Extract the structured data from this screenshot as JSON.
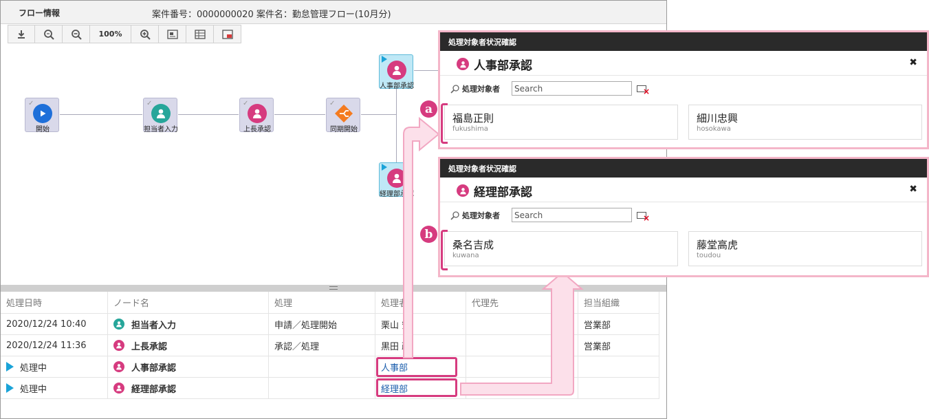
{
  "window": {
    "title": "フロー情報",
    "case_info": "案件番号：0000000020 案件名：勤怠管理フロー(10月分)"
  },
  "toolbar": {
    "zoom_label": "100%",
    "buttons": [
      "download-icon",
      "zoom-fit-icon",
      "zoom-out-icon",
      "zoom-in-icon",
      "map-icon",
      "table-icon",
      "panel-icon"
    ]
  },
  "nodes": {
    "start": "開始",
    "tantou": "担当者入力",
    "joucho": "上長承認",
    "douki": "同期開始",
    "jinji": "人事部承認",
    "keiri": "経理部承認"
  },
  "history": {
    "headers": [
      "処理日時",
      "ノード名",
      "処理",
      "処理者",
      "代理先",
      "担当組織"
    ],
    "rows": [
      {
        "date": "2020/12/24 10:40",
        "node": "担当者入力",
        "action": "申請／処理開始",
        "user": "栗山 安",
        "proxy": "",
        "org": "営業部"
      },
      {
        "date": "2020/12/24 11:36",
        "node": "上長承認",
        "action": "承認／処理",
        "user": "黒田 政",
        "proxy": "",
        "org": "営業部"
      },
      {
        "date": "処理中",
        "node": "人事部承認",
        "action": "",
        "user": "人事部",
        "proxy": "",
        "org": ""
      },
      {
        "date": "処理中",
        "node": "経理部承認",
        "action": "",
        "user": "経理部",
        "proxy": "",
        "org": ""
      }
    ]
  },
  "popups": [
    {
      "header": "処理対象者状況確認",
      "title": "人事部承認",
      "search_label": "処理対象者",
      "search_placeholder": "Search",
      "badge": "a",
      "users": [
        {
          "name": "福島正則",
          "id": "fukushima"
        },
        {
          "name": "細川忠興",
          "id": "hosokawa"
        }
      ]
    },
    {
      "header": "処理対象者状況確認",
      "title": "経理部承認",
      "search_label": "処理対象者",
      "search_placeholder": "Search",
      "badge": "b",
      "users": [
        {
          "name": "桑名吉成",
          "id": "kuwana"
        },
        {
          "name": "藤堂高虎",
          "id": "toudou"
        }
      ]
    }
  ],
  "colors": {
    "accent_pink": "#d63b7f",
    "user_teal": "#26a69a",
    "user_pink": "#d63b7f",
    "start_blue": "#1e6fd9",
    "gateway_orange": "#f47b20",
    "active_triangle": "#1aa3d8"
  }
}
